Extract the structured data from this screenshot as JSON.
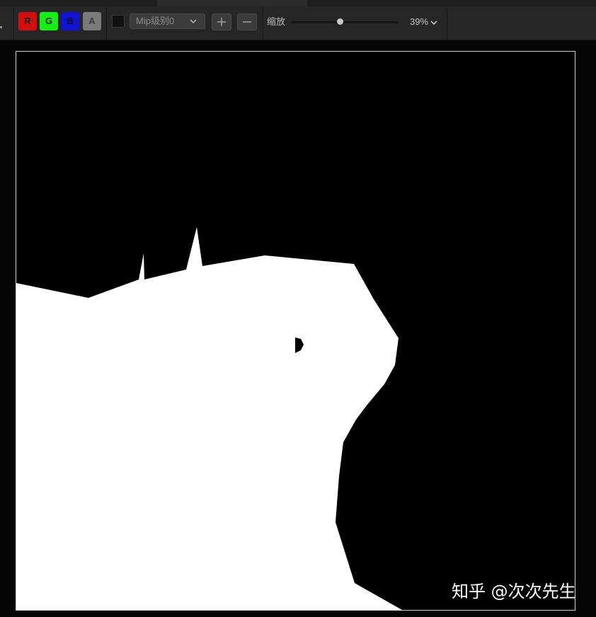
{
  "toolbar": {
    "channels": {
      "r": {
        "label": "R",
        "color": "#d10f0f"
      },
      "g": {
        "label": "G",
        "color": "#14ef14"
      },
      "b": {
        "label": "B",
        "color": "#1212d2"
      },
      "a": {
        "label": "A",
        "color": "#7a7a7a"
      }
    },
    "mip": {
      "selected": "Mip级别0",
      "icon": "chevron-down-icon"
    },
    "zoom_in_icon": "plus-icon",
    "zoom_out_icon": "minus-icon",
    "zoom": {
      "label": "缩放",
      "value": "39%",
      "slider_fraction": 0.46,
      "icon": "chevron-down-icon"
    }
  },
  "texture": {
    "content": "white silhouette mask on black background"
  },
  "watermark": {
    "text": "知乎 @次次先生"
  }
}
